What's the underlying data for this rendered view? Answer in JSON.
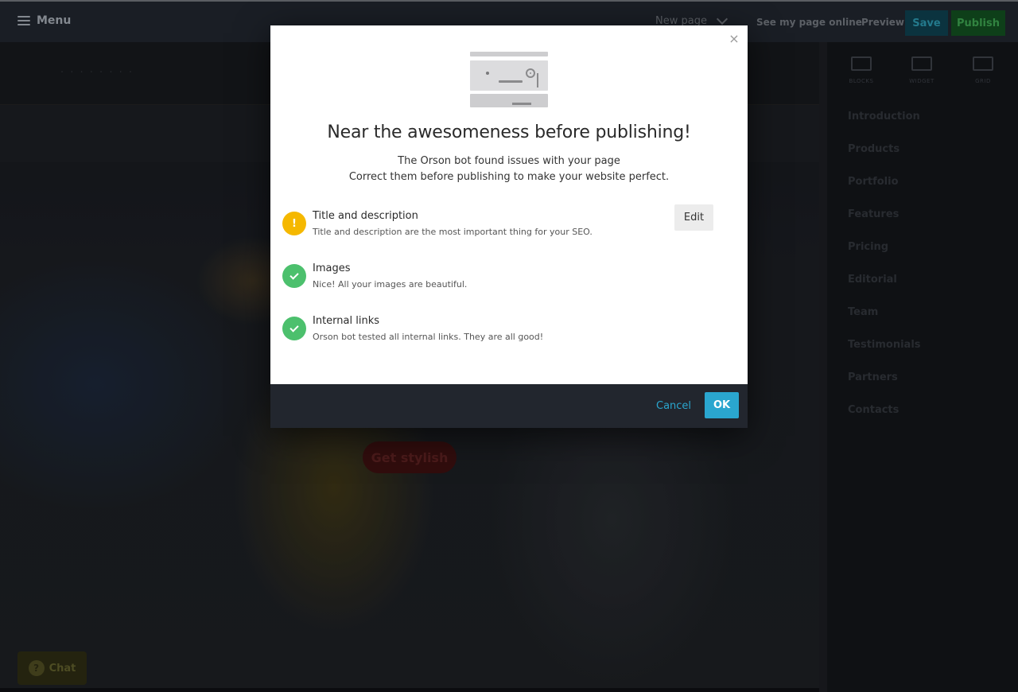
{
  "topbar": {
    "menu_label": "Menu",
    "page_selector": "New page",
    "see_online": "See my page online",
    "preview": "Preview",
    "save": "Save",
    "publish": "Publish"
  },
  "canvas": {
    "cta_label": "Get stylish",
    "chat_label": "Chat"
  },
  "right_panel": {
    "tools": [
      "BLOCKS",
      "WIDGET",
      "GRID"
    ],
    "sections": [
      "Introduction",
      "Products",
      "Portfolio",
      "Features",
      "Pricing",
      "Editorial",
      "Team",
      "Testimonials",
      "Partners",
      "Contacts"
    ]
  },
  "modal": {
    "title": "Near the awesomeness before publishing!",
    "subtitle_line1": "The Orson bot found issues with your page",
    "subtitle_line2": "Correct them before publishing to make your website perfect.",
    "checks": [
      {
        "status": "warning",
        "icon": "!",
        "title": "Title and description",
        "description": "Title and description are the most important thing for your SEO.",
        "action": "Edit"
      },
      {
        "status": "ok",
        "title": "Images",
        "description": "Nice! All your images are beautiful."
      },
      {
        "status": "ok",
        "title": "Internal links",
        "description": "Orson bot tested all internal links. They are all good!"
      }
    ],
    "cancel_label": "Cancel",
    "ok_label": "OK",
    "close_glyph": "×"
  },
  "colors": {
    "accent": "#2aa6cf",
    "warning": "#f5b800",
    "success": "#4cc06d",
    "footer_bg": "#22262e"
  }
}
